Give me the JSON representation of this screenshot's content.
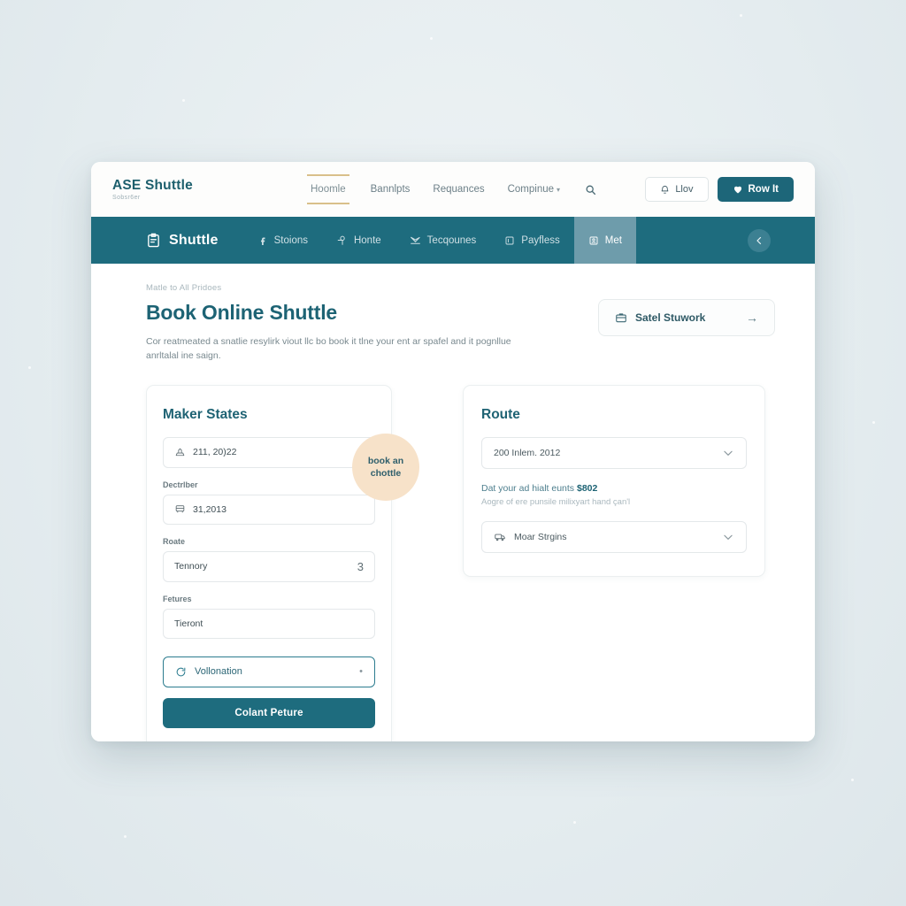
{
  "header": {
    "brand_title": "ASE Shuttle",
    "brand_sub": "Sobsr6er",
    "nav": [
      {
        "label": "Hoomle",
        "active": true
      },
      {
        "label": "Bannlpts",
        "active": false
      },
      {
        "label": "Requances",
        "active": false
      },
      {
        "label": "Compinue",
        "active": false,
        "caret": "▾"
      }
    ],
    "search_icon": "search-icon",
    "outline_button": {
      "label": "Llov",
      "icon": "bell-icon"
    },
    "primary_button": {
      "label": "Row It",
      "icon": "heart-icon"
    }
  },
  "tealbar": {
    "logo": "Shuttle",
    "logo_icon": "clipboard-icon",
    "items": [
      {
        "label": "Stoions",
        "icon": "facebook-icon",
        "active": false
      },
      {
        "label": "Honte",
        "icon": "pin-icon",
        "active": false
      },
      {
        "label": "Tecqounes",
        "icon": "plane-icon",
        "active": false
      },
      {
        "label": "Payfless",
        "icon": "card-icon",
        "active": false
      },
      {
        "label": "Met",
        "icon": "user-card-icon",
        "active": true
      }
    ],
    "back_icon": "chevron-left-icon"
  },
  "page": {
    "breadcrumb": "Matle to All Pridoes",
    "title": "Book Online Shuttle",
    "description": "Cor reatmeated a snatlie resylirk viout llc bo book it tlne your ent ar spafel and it pognllue anrltalal ine saign.",
    "stuwork_button": {
      "label": "Satel Stuwork",
      "icon": "briefcase-icon",
      "arrow": "→"
    }
  },
  "badge": {
    "line1": "book an",
    "line2": "chottle"
  },
  "left_card": {
    "title": "Maker States",
    "fields": [
      {
        "label": "",
        "icon": "ship-icon",
        "value": "211, 20)22",
        "action": "+",
        "action_name": "add-icon"
      },
      {
        "label": "Dectrlber",
        "icon": "train-icon",
        "value": "31,2013",
        "action": "",
        "action_name": ""
      },
      {
        "label": "Roate",
        "icon": "",
        "value": "Tennory",
        "action": "3",
        "action_name": "count-value"
      },
      {
        "label": "Fetures",
        "icon": "",
        "value": "Tieront",
        "action": "",
        "action_name": ""
      }
    ],
    "validation_select": {
      "label": "Vollonation",
      "icon": "refresh-icon",
      "caret": "•"
    },
    "submit_label": "Colant Peture"
  },
  "right_card": {
    "title": "Route",
    "route_select": {
      "value": "200 Inlem. 2012",
      "caret": "⌄"
    },
    "note_main_prefix": "Dat your ad hialt eunts ",
    "note_main_amount": "$802",
    "note_sub": "Aogre of ere punsile milixyart hand çan'l",
    "stops_select": {
      "value": "Moar Strgins",
      "icon": "train-icon",
      "caret": "⌄"
    }
  },
  "colors": {
    "teal": "#1e6c7e",
    "teal_dark": "#1d6374",
    "teal_light": "#6e9cab",
    "gold": "#d9c08a",
    "peach": "#f7e2c9",
    "page_bg": "#e7eef1"
  }
}
